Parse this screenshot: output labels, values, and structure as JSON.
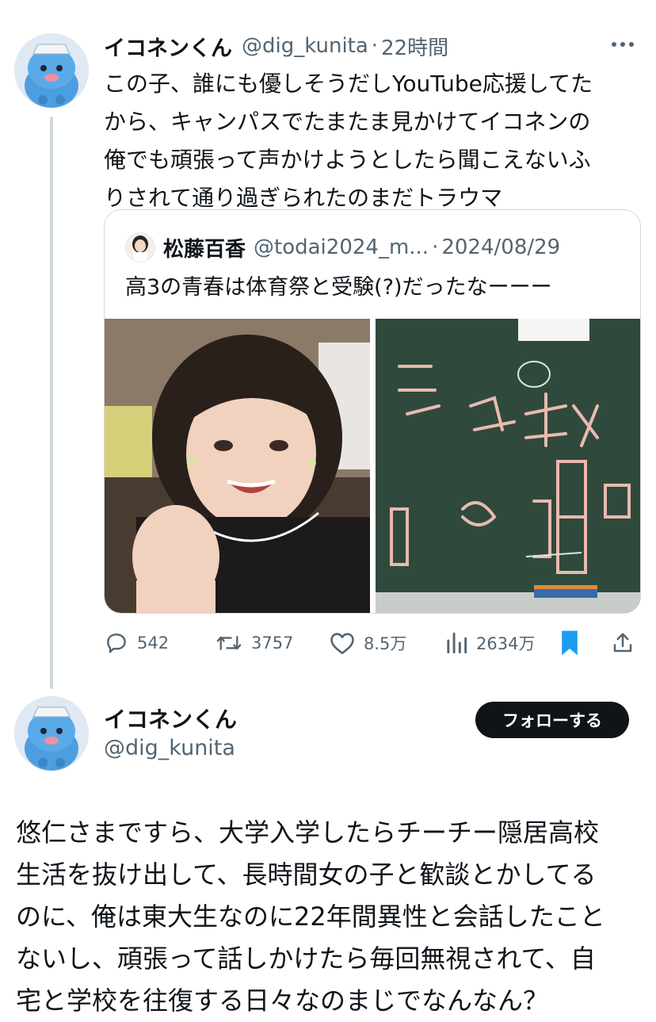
{
  "tweet": {
    "author_name": "イコネンくん",
    "handle": "@dig_kunita",
    "separator": "·",
    "time": "22時間",
    "text": "この子、誰にも優しそうだしYouTube応援してた\nから、キャンパスでたまたま見かけてイコネンの\n俺でも頑張って声かけようとしたら聞こえないふ\nりされて通り過ぎられたのまだトラウマ",
    "more_icon": "more-dots-icon",
    "stats": {
      "replies": "542",
      "retweets": "3757",
      "likes": "8.5万",
      "views": "2634万"
    }
  },
  "quote": {
    "author_name": "松藤百香",
    "handle": "@todai2024_m...",
    "separator": "·",
    "date": "2024/08/29",
    "text": "高3の青春は体育祭と受験(?)だったなーーー"
  },
  "reply": {
    "author_name": "イコネンくん",
    "handle": "@dig_kunita",
    "follow_label": "フォローする",
    "text": "悠仁さまですら、大学入学したらチーチー隠居高校\n生活を抜け出して、長時間女の子と歓談とかしてる\nのに、俺は東大生なのに22年間異性と会話したこと\nないし、頑張って話しかけたら毎回無視されて、自\n宅と学校を往復する日々なのまじでなんなん？"
  },
  "colors": {
    "text": "#0f1419",
    "secondary": "#536471",
    "bookmark_active": "#1d9bf0",
    "border": "#cfd9de",
    "follow_bg": "#0f1419"
  }
}
